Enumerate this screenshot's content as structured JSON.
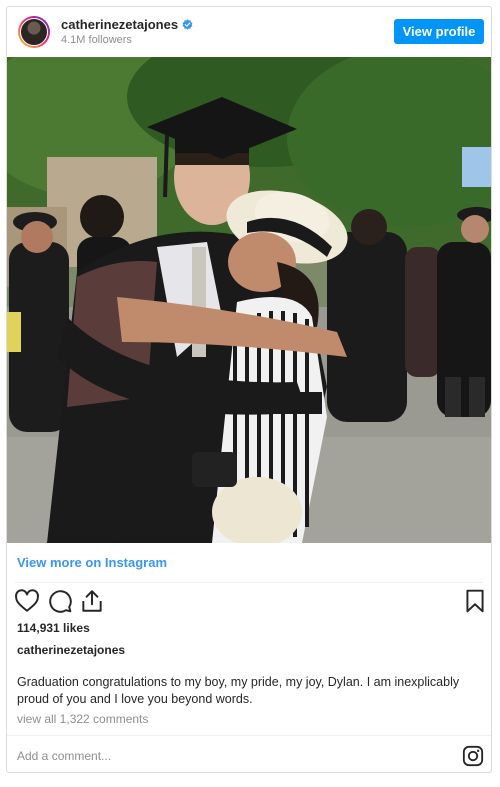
{
  "header": {
    "username": "catherinezetajones",
    "followers": "4.1M followers",
    "view_profile_label": "View profile"
  },
  "links": {
    "view_more": "View more on Instagram"
  },
  "post": {
    "likes": "114,931 likes",
    "caption_user": "catherinezetajones",
    "caption": "Graduation congratulations to my boy, my pride, my joy, Dylan. I am inexplicably proud of you and I love you beyond words.",
    "comments_link": "view all 1,322 comments"
  },
  "comment_box": {
    "placeholder": "Add a comment..."
  },
  "icons": {
    "verified": "verified-badge-icon",
    "like": "heart-icon",
    "comment": "comment-bubble-icon",
    "share": "share-icon",
    "save": "bookmark-icon",
    "instagram": "instagram-logo-icon"
  },
  "colors": {
    "accent": "#0095f6",
    "link": "#3897f0",
    "muted": "#8e8e8e",
    "text": "#262626"
  }
}
